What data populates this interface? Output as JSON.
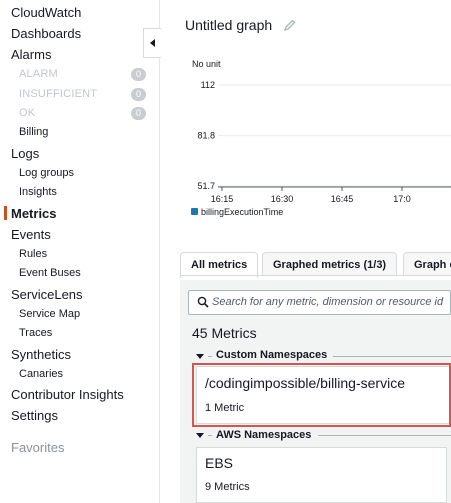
{
  "sidebar": {
    "items": [
      {
        "label": "CloudWatch"
      },
      {
        "label": "Dashboards"
      },
      {
        "label": "Alarms"
      },
      {
        "label": "ALARM",
        "badge": "0"
      },
      {
        "label": "INSUFFICIENT",
        "badge": "0"
      },
      {
        "label": "OK",
        "badge": "0"
      },
      {
        "label": "Billing"
      },
      {
        "label": "Logs"
      },
      {
        "label": "Log groups"
      },
      {
        "label": "Insights"
      },
      {
        "label": "Metrics"
      },
      {
        "label": "Events"
      },
      {
        "label": "Rules"
      },
      {
        "label": "Event Buses"
      },
      {
        "label": "ServiceLens"
      },
      {
        "label": "Service Map"
      },
      {
        "label": "Traces"
      },
      {
        "label": "Synthetics"
      },
      {
        "label": "Canaries"
      },
      {
        "label": "Contributor Insights"
      },
      {
        "label": "Settings"
      },
      {
        "label": "Favorites"
      }
    ],
    "active_item": "Metrics",
    "accent_color": "#c7511f"
  },
  "graph": {
    "title": "Untitled graph",
    "edit_icon": "pencil-icon"
  },
  "chart_data": {
    "type": "line",
    "ylabel": "No unit",
    "yticks": [
      112,
      81.8,
      51.7
    ],
    "ylim": [
      51.7,
      112
    ],
    "xticks": [
      "16:15",
      "16:30",
      "16:45",
      "17:0"
    ],
    "series": [
      {
        "name": "billingExecutionTime",
        "values": []
      }
    ],
    "grid": true,
    "legend": "bottom-left"
  },
  "tabs": [
    {
      "label": "All metrics",
      "active": true
    },
    {
      "label": "Graphed metrics (1/3)",
      "active": false
    },
    {
      "label": "Graph o",
      "active": false
    }
  ],
  "search": {
    "placeholder": "Search for any metric, dimension or resource id",
    "value": ""
  },
  "metrics": {
    "count_label": "45 Metrics",
    "custom_namespaces_label": "Custom Namespaces",
    "aws_namespaces_label": "AWS Namespaces",
    "custom": [
      {
        "name": "/codingimpossible/billing-service",
        "count": "1 Metric"
      }
    ],
    "aws": [
      {
        "name": "EBS",
        "count": "9 Metrics"
      }
    ],
    "highlight_color": "#d9534f"
  }
}
